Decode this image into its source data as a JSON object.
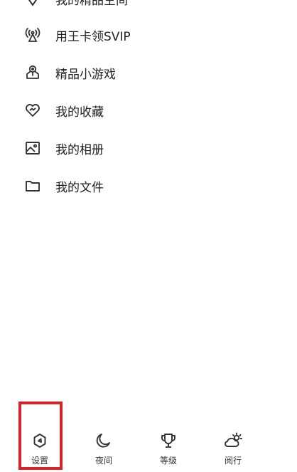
{
  "menu": {
    "items": [
      {
        "label": "我的精品空间",
        "icon": "location-pin-icon"
      },
      {
        "label": "用王卡领SVIP",
        "icon": "signal-tower-icon"
      },
      {
        "label": "精品小游戏",
        "icon": "gamepad-pin-icon"
      },
      {
        "label": "我的收藏",
        "icon": "heart-icon"
      },
      {
        "label": "我的相册",
        "icon": "photo-album-icon"
      },
      {
        "label": "我的文件",
        "icon": "folder-icon"
      }
    ]
  },
  "bottom_bar": {
    "items": [
      {
        "label": "设置",
        "icon": "settings-hexagon-icon"
      },
      {
        "label": "夜间",
        "icon": "moon-icon"
      },
      {
        "label": "等级",
        "icon": "trophy-icon"
      },
      {
        "label": "阅行",
        "icon": "weather-cloud-sun-icon"
      }
    ]
  },
  "colors": {
    "highlight": "#d7232b",
    "icon_stroke": "#333333"
  }
}
